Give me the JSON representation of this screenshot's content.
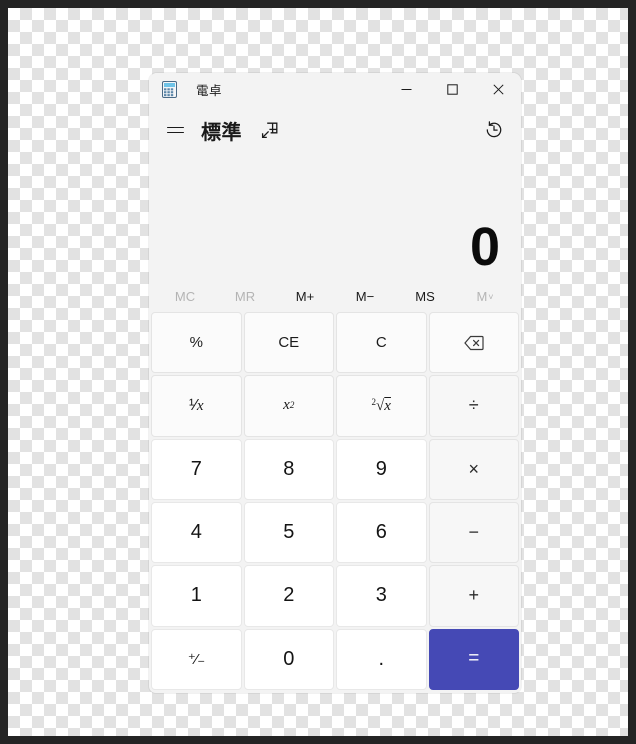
{
  "window": {
    "app_icon": "calculator-icon",
    "title": "電卓",
    "controls": {
      "minimize": "minimize-icon",
      "maximize": "maximize-icon",
      "close": "close-icon"
    }
  },
  "header": {
    "menu_icon": "hamburger-menu-icon",
    "mode_title": "標準",
    "keep_on_top_icon": "keep-on-top-icon",
    "history_icon": "history-icon"
  },
  "display": {
    "expression": "",
    "result": "0"
  },
  "memory": {
    "buttons": [
      {
        "label": "MC",
        "name": "memory-clear-button",
        "disabled": true,
        "chevron": false
      },
      {
        "label": "MR",
        "name": "memory-recall-button",
        "disabled": true,
        "chevron": false
      },
      {
        "label": "M+",
        "name": "memory-add-button",
        "disabled": false,
        "chevron": false
      },
      {
        "label": "M−",
        "name": "memory-subtract-button",
        "disabled": false,
        "chevron": false
      },
      {
        "label": "MS",
        "name": "memory-store-button",
        "disabled": false,
        "chevron": false
      },
      {
        "label": "M",
        "name": "memory-open-button",
        "disabled": true,
        "chevron": true
      }
    ]
  },
  "keypad": {
    "rows": [
      [
        {
          "label": "%",
          "name": "percent-button",
          "kind": "fn"
        },
        {
          "label": "CE",
          "name": "clear-entry-button",
          "kind": "fn"
        },
        {
          "label": "C",
          "name": "clear-button",
          "kind": "fn"
        },
        {
          "label": "⌫",
          "name": "backspace-button",
          "kind": "fn"
        }
      ],
      [
        {
          "label": "1/x",
          "name": "reciprocal-button",
          "kind": "fn"
        },
        {
          "label": "x²",
          "name": "square-button",
          "kind": "fn"
        },
        {
          "label": "2√x",
          "name": "square-root-button",
          "kind": "fn"
        },
        {
          "label": "÷",
          "name": "divide-button",
          "kind": "op"
        }
      ],
      [
        {
          "label": "7",
          "name": "digit-7-button",
          "kind": "num"
        },
        {
          "label": "8",
          "name": "digit-8-button",
          "kind": "num"
        },
        {
          "label": "9",
          "name": "digit-9-button",
          "kind": "num"
        },
        {
          "label": "×",
          "name": "multiply-button",
          "kind": "op"
        }
      ],
      [
        {
          "label": "4",
          "name": "digit-4-button",
          "kind": "num"
        },
        {
          "label": "5",
          "name": "digit-5-button",
          "kind": "num"
        },
        {
          "label": "6",
          "name": "digit-6-button",
          "kind": "num"
        },
        {
          "label": "−",
          "name": "subtract-button",
          "kind": "op"
        }
      ],
      [
        {
          "label": "1",
          "name": "digit-1-button",
          "kind": "num"
        },
        {
          "label": "2",
          "name": "digit-2-button",
          "kind": "num"
        },
        {
          "label": "3",
          "name": "digit-3-button",
          "kind": "num"
        },
        {
          "label": "+",
          "name": "add-button",
          "kind": "op"
        }
      ],
      [
        {
          "label": "+/−",
          "name": "plus-minus-button",
          "kind": "num"
        },
        {
          "label": "0",
          "name": "digit-0-button",
          "kind": "num"
        },
        {
          "label": ".",
          "name": "decimal-point-button",
          "kind": "num"
        },
        {
          "label": "=",
          "name": "equals-button",
          "kind": "equals"
        }
      ]
    ]
  },
  "colors": {
    "accent": "#4549B5",
    "window_bg": "#F3F3F3",
    "key_bg": "#FBFBFB",
    "number_key_bg": "#FFFFFF",
    "text": "#1B1B1B",
    "disabled_text": "#B4B4B4"
  }
}
